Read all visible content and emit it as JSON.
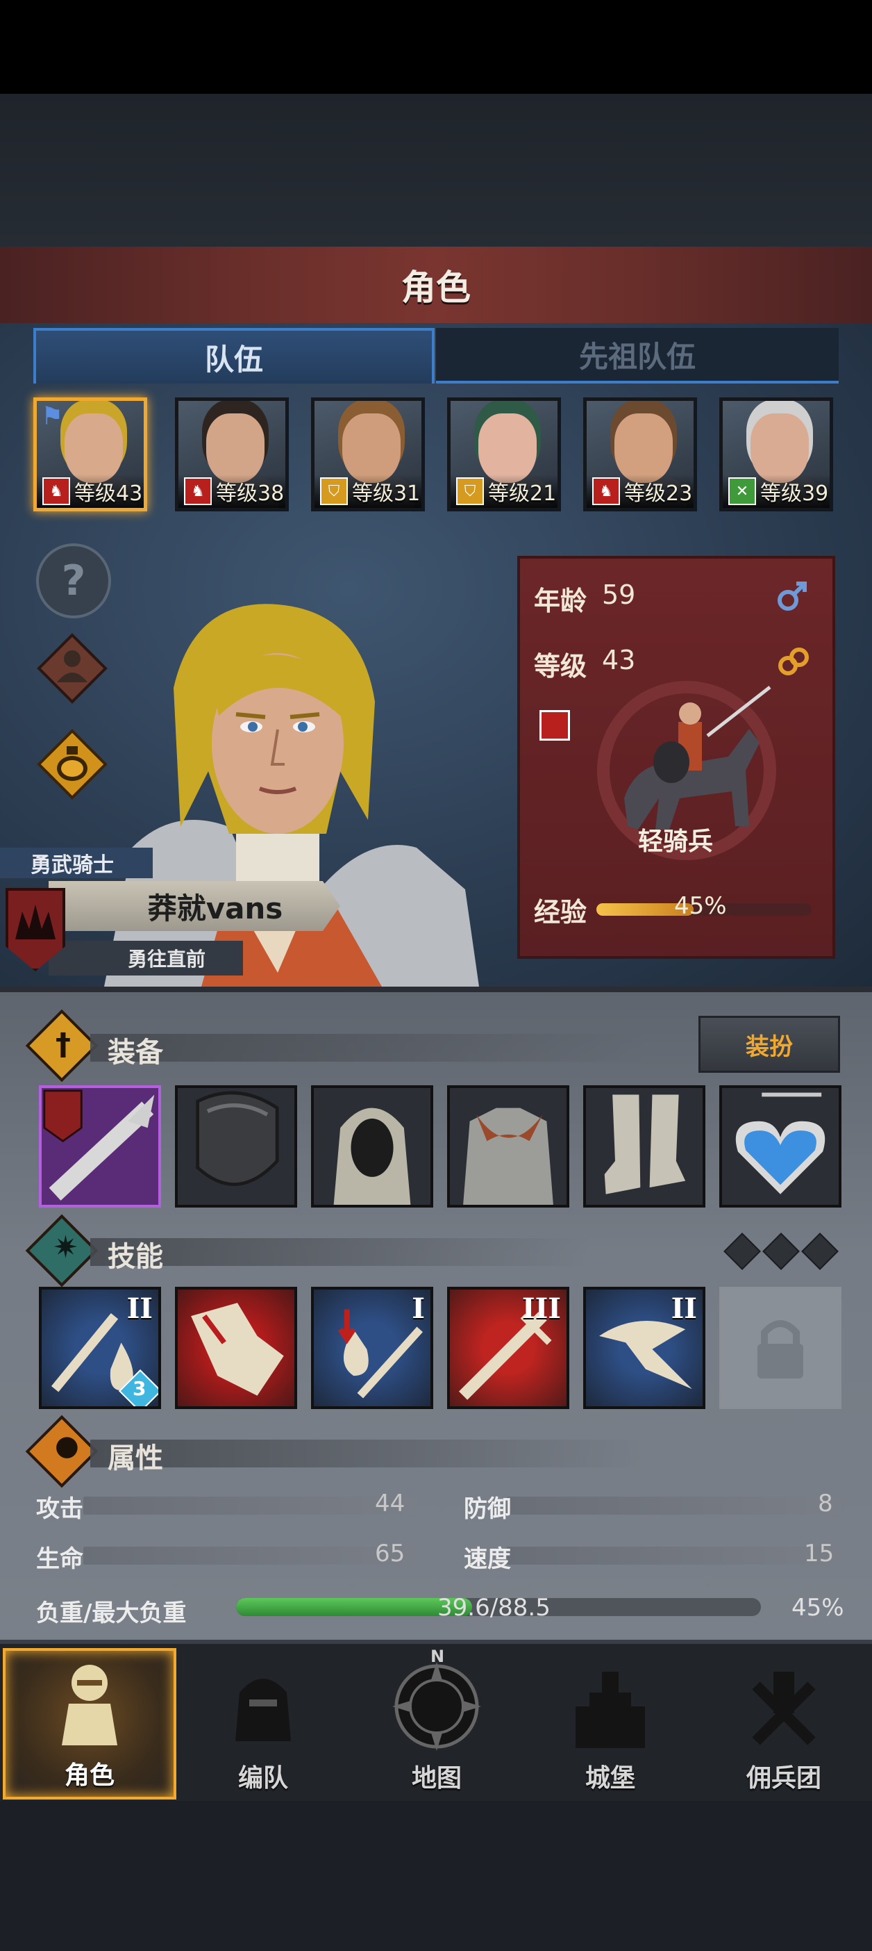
{
  "title": "角色",
  "tabs": [
    {
      "label": "队伍",
      "active": true
    },
    {
      "label": "先祖队伍",
      "active": false
    }
  ],
  "party": [
    {
      "level_text": "等级43",
      "class_icon": "cavalry-icon",
      "class_color": "#b8201e",
      "selected": true,
      "leader_flag": true,
      "hair": "#c9a52a",
      "skin": "#d8a98a"
    },
    {
      "level_text": "等级38",
      "class_icon": "cavalry-icon",
      "class_color": "#b8201e",
      "selected": false,
      "hair": "#2e2420",
      "skin": "#d3a588"
    },
    {
      "level_text": "等级31",
      "class_icon": "shield-icon",
      "class_color": "#d69a1f",
      "selected": false,
      "hair": "#8a5d32",
      "skin": "#cf9d7b"
    },
    {
      "level_text": "等级21",
      "class_icon": "shield-icon",
      "class_color": "#d69a1f",
      "selected": false,
      "hair": "#2f5a48",
      "skin": "#e2b4a0"
    },
    {
      "level_text": "等级23",
      "class_icon": "cavalry-icon",
      "class_color": "#b8201e",
      "selected": false,
      "hair": "#6b4a30",
      "skin": "#d2a07e"
    },
    {
      "level_text": "等级39",
      "class_icon": "crossed-weapons-icon",
      "class_color": "#3f9a3a",
      "selected": false,
      "hair": "#cfcfcf",
      "skin": "#d9ab92"
    }
  ],
  "stats": {
    "age_label": "年龄",
    "age_value": "59",
    "level_label": "等级",
    "level_value": "43",
    "unit_class": "轻骑兵",
    "exp_label": "经验",
    "exp_text": "45%",
    "exp_fraction": 0.45
  },
  "character": {
    "rank": "勇武骑士",
    "name": "莽就vans",
    "motto": "勇往直前"
  },
  "equipment": {
    "title": "装备",
    "dress_button": "装扮",
    "slots": [
      "lance-icon",
      "shield-icon",
      "mail-hood-icon",
      "chainmail-armor-icon",
      "mail-boots-icon",
      "heart-amulet-icon"
    ]
  },
  "skills": {
    "title": "技能",
    "items": [
      {
        "icon": "sword-drop-icon",
        "rank": "II",
        "bg": "#2e4f86",
        "badge": "3"
      },
      {
        "icon": "charge-icon",
        "rank": "",
        "bg": "#b81c1c",
        "badge": ""
      },
      {
        "icon": "bleed-sword-icon",
        "rank": "I",
        "bg": "#2e4f86",
        "badge": ""
      },
      {
        "icon": "sword-strike-icon",
        "rank": "III",
        "bg": "#c02420",
        "badge": ""
      },
      {
        "icon": "horse-head-icon",
        "rank": "II",
        "bg": "#2e4f86",
        "badge": ""
      }
    ]
  },
  "attributes": {
    "title": "属性",
    "rows": [
      {
        "left_label": "攻击",
        "left_value": "44",
        "right_label": "防御",
        "right_value": "8"
      },
      {
        "left_label": "生命",
        "left_value": "65",
        "right_label": "速度",
        "right_value": "15"
      }
    ],
    "load_label": "负重/最大负重",
    "load_text": "39.6/88.5",
    "load_percent": "45%",
    "load_fraction": 0.45
  },
  "nav": [
    {
      "label": "角色",
      "icon": "knight-icon",
      "active": true
    },
    {
      "label": "编队",
      "icon": "helmet-icon",
      "active": false
    },
    {
      "label": "地图",
      "icon": "compass-icon",
      "active": false
    },
    {
      "label": "城堡",
      "icon": "castle-icon",
      "active": false
    },
    {
      "label": "佣兵团",
      "icon": "mercenary-icon",
      "active": false
    }
  ],
  "colors": {
    "accent_gold": "#f0a830",
    "tab_blue": "#3d7ecb",
    "panel_red": "#6b2628",
    "exp_bar": "#e3a236",
    "load_bar": "#3fae46"
  }
}
